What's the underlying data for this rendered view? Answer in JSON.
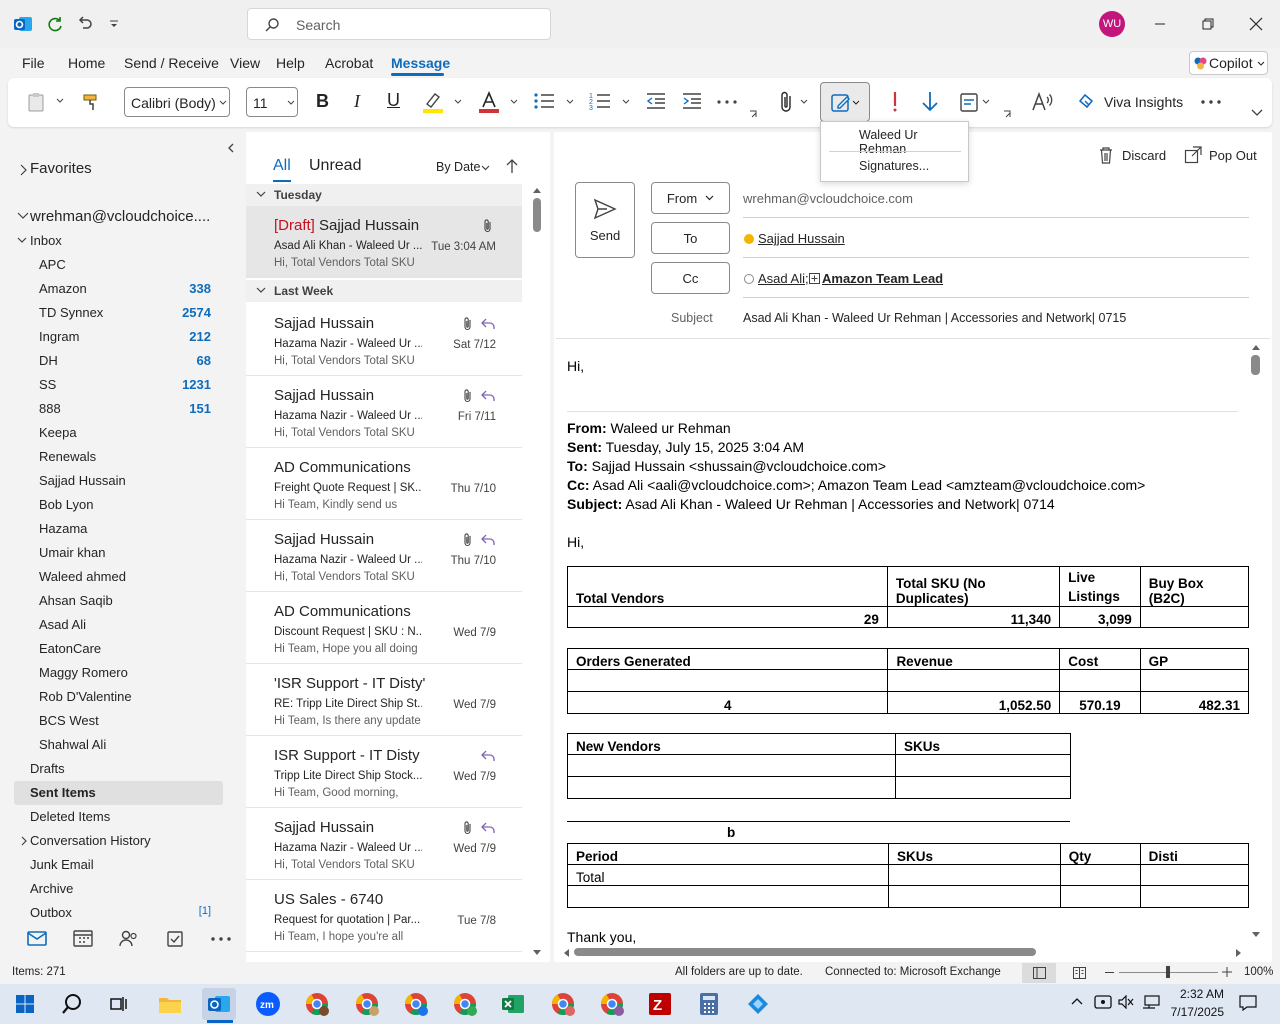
{
  "titlebar": {
    "search_placeholder": "Search",
    "avatar_initials": "WU"
  },
  "menu": {
    "items": [
      "File",
      "Home",
      "Send / Receive",
      "View",
      "Help",
      "Acrobat",
      "Message"
    ],
    "active": "Message",
    "copilot": "Copilot"
  },
  "ribbon": {
    "font_name": "Calibri (Body)",
    "font_size": "11",
    "viva": "Viva Insights"
  },
  "signature_menu": {
    "item1": "Waleed Ur Rehman",
    "item2": "Signatures..."
  },
  "folders": {
    "favorites": "Favorites",
    "account": "wrehman@vcloudchoice....",
    "inbox": "Inbox",
    "subfolders": [
      {
        "name": "APC",
        "count": ""
      },
      {
        "name": "Amazon",
        "count": "338"
      },
      {
        "name": "TD Synnex",
        "count": "2574"
      },
      {
        "name": "Ingram",
        "count": "212"
      },
      {
        "name": "DH",
        "count": "68"
      },
      {
        "name": "SS",
        "count": "1231"
      },
      {
        "name": "888",
        "count": "151"
      },
      {
        "name": "Keepa",
        "count": ""
      },
      {
        "name": "Renewals",
        "count": ""
      },
      {
        "name": "Sajjad Hussain",
        "count": ""
      },
      {
        "name": "Bob Lyon",
        "count": ""
      },
      {
        "name": "Hazama",
        "count": ""
      },
      {
        "name": "Umair khan",
        "count": ""
      },
      {
        "name": "Waleed ahmed",
        "count": ""
      },
      {
        "name": "Ahsan Saqib",
        "count": ""
      },
      {
        "name": "Asad Ali",
        "count": ""
      },
      {
        "name": "EatonCare",
        "count": ""
      },
      {
        "name": "Maggy Romero",
        "count": ""
      },
      {
        "name": "Rob D'Valentine",
        "count": ""
      },
      {
        "name": "BCS West",
        "count": ""
      },
      {
        "name": "Shahwal Ali",
        "count": ""
      }
    ],
    "top": [
      {
        "name": "Drafts"
      },
      {
        "name": "Sent Items"
      },
      {
        "name": "Deleted Items"
      },
      {
        "name": "Conversation History"
      },
      {
        "name": "Junk Email"
      },
      {
        "name": "Archive"
      },
      {
        "name": "Outbox"
      }
    ],
    "outbox_count": "[1]"
  },
  "list": {
    "tab_all": "All",
    "tab_unread": "Unread",
    "sort": "By Date",
    "group_tuesday": "Tuesday",
    "group_lastweek": "Last Week",
    "items": [
      {
        "draft": "[Draft]",
        "sender": "Sajjad Hussain",
        "subject": "Asad Ali Khan - Waleed Ur ...",
        "preview": "Hi,  Total Vendors  Total SKU",
        "date": "Tue 3:04 AM"
      },
      {
        "sender": "Sajjad Hussain",
        "subject": "Hazama Nazir - Waleed Ur ...",
        "preview": "Hi,  Total Vendors  Total SKU",
        "date": "Sat 7/12"
      },
      {
        "sender": "Sajjad Hussain",
        "subject": "Hazama Nazir - Waleed Ur ...",
        "preview": "Hi,  Total Vendors  Total SKU",
        "date": "Fri 7/11"
      },
      {
        "sender": "AD Communications",
        "subject": "Freight Quote Request | SK...",
        "preview": "Hi Team,  Kindly send us",
        "date": "Thu 7/10"
      },
      {
        "sender": "Sajjad Hussain",
        "subject": "Hazama Nazir - Waleed Ur ...",
        "preview": "Hi,  Total Vendors  Total SKU",
        "date": "Thu 7/10"
      },
      {
        "sender": "AD Communications",
        "subject": "Discount Request | SKU : N...",
        "preview": "Hi Team,  Hope you all doing",
        "date": "Wed 7/9"
      },
      {
        "sender": "'ISR Support - IT Disty'",
        "subject": "RE: Tripp Lite Direct Ship St...",
        "preview": "Hi Team,  Is there any update",
        "date": "Wed 7/9"
      },
      {
        "sender": "ISR Support - IT Disty",
        "subject": "Tripp Lite Direct Ship Stock...",
        "preview": "Hi Team,  Good morning,",
        "date": "Wed 7/9"
      },
      {
        "sender": "Sajjad Hussain",
        "subject": "Hazama Nazir - Waleed Ur ...",
        "preview": "Hi,  Total Vendors  Total SKU",
        "date": "Wed 7/9"
      },
      {
        "sender": "US Sales - 6740",
        "subject": "Request for quotation | Par...",
        "preview": "Hi Team,  I hope you're all",
        "date": "Tue 7/8"
      }
    ]
  },
  "compose": {
    "discard": "Discard",
    "popout": "Pop Out",
    "send": "Send",
    "from_label": "From",
    "from_value": "wrehman@vcloudchoice.com",
    "to_label": "To",
    "to_value": "Sajjad Hussain",
    "cc_label": "Cc",
    "cc_value1": "Asad Ali;",
    "cc_value2": "Amazon Team Lead",
    "subject_label": "Subject",
    "subject_value": "Asad Ali Khan - Waleed Ur Rehman | Accessories and Network| 0715"
  },
  "body": {
    "greeting": "Hi,",
    "from_k": "From:",
    "from_v": " Waleed ur Rehman",
    "sent_k": "Sent:",
    "sent_v": " Tuesday, July 15, 2025 3:04 AM",
    "to_k": "To:",
    "to_v": " Sajjad Hussain <shussain@vcloudchoice.com>",
    "cc_k": "Cc:",
    "cc_v": " Asad Ali <aali@vcloudchoice.com>; Amazon Team Lead <amzteam@vcloudchoice.com>",
    "subj_k": "Subject:",
    "subj_v": " Asad Ali Khan - Waleed Ur Rehman | Accessories and Network| 0714",
    "greeting2": "Hi,",
    "t1": {
      "h1": "Total Vendors",
      "h2": "Total SKU (No Duplicates)",
      "h3a": "Live",
      "h3b": "Listings",
      "h4": "Buy Box (B2C)",
      "v1": "29",
      "v2": "11,340",
      "v3": "3,099"
    },
    "t2": {
      "h1": "Orders Generated",
      "h2": "Revenue",
      "h3": "Cost",
      "h4": "GP",
      "v1": "4",
      "v2": "1,052.50",
      "v3": "570.19",
      "v4": "482.31"
    },
    "t3": {
      "h1": "New Vendors",
      "h2": "SKUs"
    },
    "t4": {
      "b": "b",
      "h1": "Period",
      "h2": "SKUs",
      "h3": "Qty",
      "h4": "Disti",
      "r1": "Total"
    },
    "thanks": "Thank you,"
  },
  "status": {
    "items": "Items: 271",
    "sync": "All folders are up to date.",
    "conn": "Connected to: Microsoft Exchange",
    "zoom": "100%"
  },
  "taskbar": {
    "time": "2:32 AM",
    "date": "7/17/2025"
  }
}
